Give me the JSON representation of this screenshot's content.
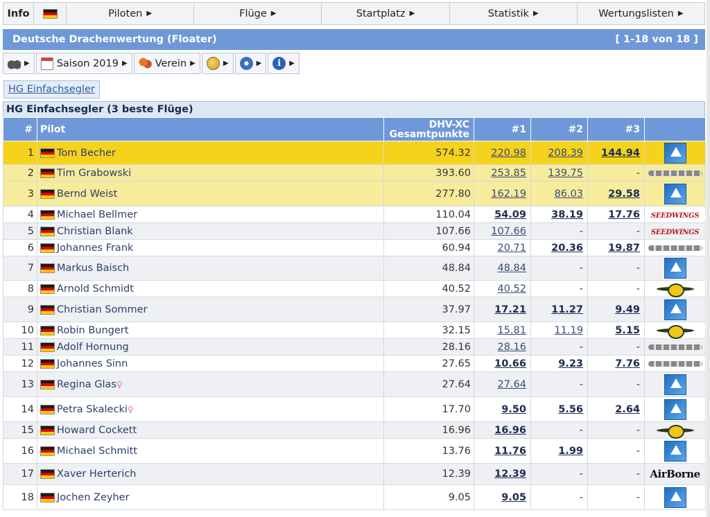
{
  "topnav": {
    "info": "Info",
    "menus": [
      {
        "label": "Piloten"
      },
      {
        "label": "Flüge"
      },
      {
        "label": "Startplatz"
      },
      {
        "label": "Statistik"
      },
      {
        "label": "Wertungslisten"
      }
    ]
  },
  "titlebar": {
    "title": "Deutsche Drachenwertung (Floater)",
    "range": "[ 1-18 von 18 ]"
  },
  "toolbar": {
    "season": "Saison 2019",
    "club": "Verein"
  },
  "category_link": "HG Einfachsegler",
  "ranking": {
    "caption": "HG Einfachsegler (3 beste Flüge)",
    "columns": {
      "rank": "#",
      "pilot": "Pilot",
      "total_line1": "DHV-XC",
      "total_line2": "Gesamtpunkte",
      "f1": "#1",
      "f2": "#2",
      "f3": "#3"
    },
    "rows": [
      {
        "rank": "1",
        "pilot": "Tom Becher",
        "female": "",
        "total": "574.32",
        "f1": "220.98",
        "f2": "208.39",
        "f3": "144.94",
        "logo": "aeros"
      },
      {
        "rank": "2",
        "pilot": "Tim Grabowski",
        "female": "",
        "total": "393.60",
        "f1": "253.85",
        "f2": "139.75",
        "f3": "-",
        "logo": "icaro"
      },
      {
        "rank": "3",
        "pilot": "Bernd Weist",
        "female": "",
        "total": "277.80",
        "f1": "162.19",
        "f2": "86.03",
        "f3": "29.58",
        "logo": "aeros"
      },
      {
        "rank": "4",
        "pilot": "Michael Bellmer",
        "female": "",
        "total": "110.04",
        "f1": "54.09",
        "f2": "38.19",
        "f3": "17.76",
        "logo": "seedwings"
      },
      {
        "rank": "5",
        "pilot": "Christian Blank",
        "female": "",
        "total": "107.66",
        "f1": "107.66",
        "f2": "-",
        "f3": "-",
        "logo": "seedwings"
      },
      {
        "rank": "6",
        "pilot": "Johannes Frank",
        "female": "",
        "total": "60.94",
        "f1": "20.71",
        "f2": "20.36",
        "f3": "19.87",
        "logo": "icaro"
      },
      {
        "rank": "7",
        "pilot": "Markus Baisch",
        "female": "",
        "total": "48.84",
        "f1": "48.84",
        "f2": "-",
        "f3": "-",
        "logo": "aeros"
      },
      {
        "rank": "8",
        "pilot": "Arnold Schmidt",
        "female": "",
        "total": "40.52",
        "f1": "40.52",
        "f2": "-",
        "f3": "-",
        "logo": "wills"
      },
      {
        "rank": "9",
        "pilot": "Christian Sommer",
        "female": "",
        "total": "37.97",
        "f1": "17.21",
        "f2": "11.27",
        "f3": "9.49",
        "logo": "aeros"
      },
      {
        "rank": "10",
        "pilot": "Robin Bungert",
        "female": "",
        "total": "32.15",
        "f1": "15.81",
        "f2": "11.19",
        "f3": "5.15",
        "logo": "wills"
      },
      {
        "rank": "11",
        "pilot": "Adolf Hornung",
        "female": "",
        "total": "28.16",
        "f1": "28.16",
        "f2": "-",
        "f3": "-",
        "logo": "icaro"
      },
      {
        "rank": "12",
        "pilot": "Johannes Sinn",
        "female": "",
        "total": "27.65",
        "f1": "10.66",
        "f2": "9.23",
        "f3": "7.76",
        "logo": "icaro"
      },
      {
        "rank": "13",
        "pilot": "Regina Glas",
        "female": "♀",
        "total": "27.64",
        "f1": "27.64",
        "f2": "-",
        "f3": "-",
        "logo": "aeros"
      },
      {
        "rank": "14",
        "pilot": "Petra Skalecki",
        "female": "♀",
        "total": "17.70",
        "f1": "9.50",
        "f2": "5.56",
        "f3": "2.64",
        "logo": "aeros"
      },
      {
        "rank": "15",
        "pilot": "Howard Cockett",
        "female": "",
        "total": "16.96",
        "f1": "16.96",
        "f2": "-",
        "f3": "-",
        "logo": "wills"
      },
      {
        "rank": "16",
        "pilot": "Michael Schmitt",
        "female": "",
        "total": "13.76",
        "f1": "11.76",
        "f2": "1.99",
        "f3": "-",
        "logo": "aeros"
      },
      {
        "rank": "17",
        "pilot": "Xaver Herterich",
        "female": "",
        "total": "12.39",
        "f1": "12.39",
        "f2": "-",
        "f3": "-",
        "logo": "airborne"
      },
      {
        "rank": "18",
        "pilot": "Jochen Zeyher",
        "female": "",
        "total": "9.05",
        "f1": "9.05",
        "f2": "-",
        "f3": "-",
        "logo": "aeros"
      }
    ],
    "logo_text": {
      "seedwings": "SEEDWINGS",
      "airborne": "AirBorne"
    }
  }
}
